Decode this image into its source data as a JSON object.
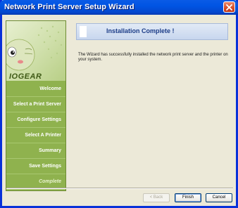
{
  "window": {
    "title": "Network Print Server Setup Wizard"
  },
  "sidebar": {
    "brand": "IOGEAR",
    "items": [
      {
        "label": "Welcome"
      },
      {
        "label": "Select a Print Server"
      },
      {
        "label": "Configure Settings"
      },
      {
        "label": "Select A Printer"
      },
      {
        "label": "Summary"
      },
      {
        "label": "Save Settings"
      },
      {
        "label": "Complete"
      }
    ]
  },
  "main": {
    "heading": "Installation Complete !",
    "message": "The Wizard has successfully installed the network print server and the printer on your system."
  },
  "buttons": {
    "back": "< Back",
    "finish": "Finish",
    "cancel": "Cancel"
  },
  "colors": {
    "title_bar": "#0054E3",
    "sidebar": "#8FB24E",
    "banner_text": "#1B3C87",
    "close_button": "#D44C27"
  }
}
